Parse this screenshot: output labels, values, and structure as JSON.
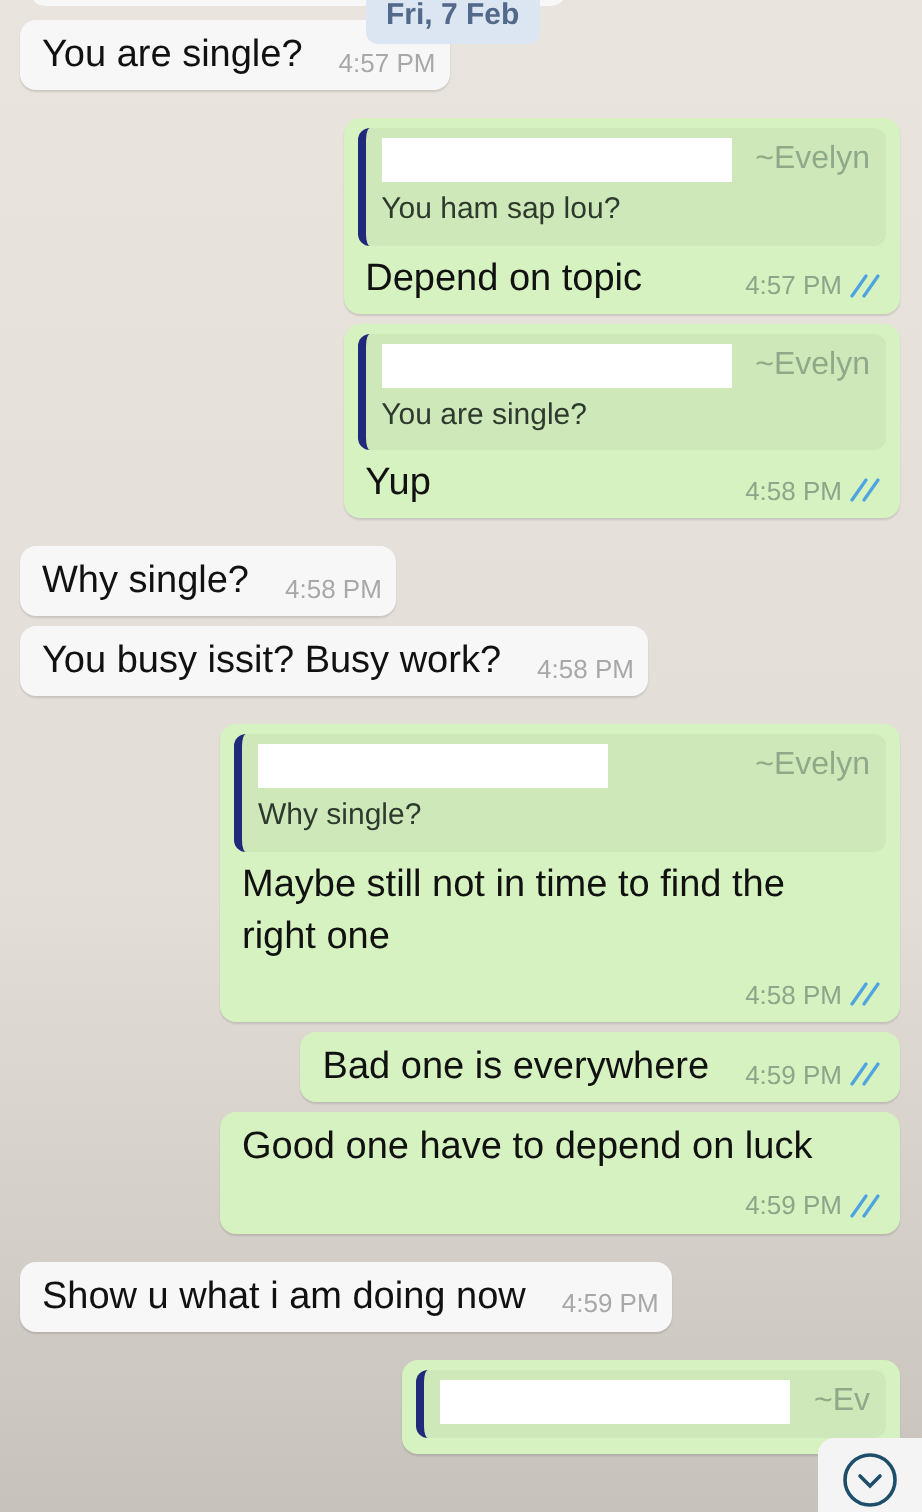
{
  "date_chip": "Fri, 7 Feb",
  "messages": [
    {
      "kind": "incoming",
      "text": "You are single?",
      "time": "4:57 PM"
    },
    {
      "kind": "outgoing",
      "quote": {
        "author": "~Evelyn",
        "text": "You ham sap lou?"
      },
      "text": "Depend on topic",
      "time": "4:57 PM",
      "read": true
    },
    {
      "kind": "outgoing",
      "quote": {
        "author": "~Evelyn",
        "text": "You are single?"
      },
      "text": "Yup",
      "time": "4:58 PM",
      "read": true
    },
    {
      "kind": "incoming",
      "text": "Why single?",
      "time": "4:58 PM"
    },
    {
      "kind": "incoming",
      "text": "You busy issit? Busy work?",
      "time": "4:58 PM"
    },
    {
      "kind": "outgoing",
      "quote": {
        "author": "~Evelyn",
        "text": "Why single?"
      },
      "text": "Maybe still not in time to find the right one",
      "time": "4:58 PM",
      "read": true
    },
    {
      "kind": "outgoing",
      "text": "Bad one is everywhere",
      "time": "4:59 PM",
      "read": true
    },
    {
      "kind": "outgoing",
      "text": "Good one have to depend on luck",
      "time": "4:59 PM",
      "read": true
    },
    {
      "kind": "incoming",
      "text": "Show u what i am doing now",
      "time": "4:59 PM"
    },
    {
      "kind": "outgoing",
      "quote": {
        "author": "~Ev"
      }
    }
  ]
}
